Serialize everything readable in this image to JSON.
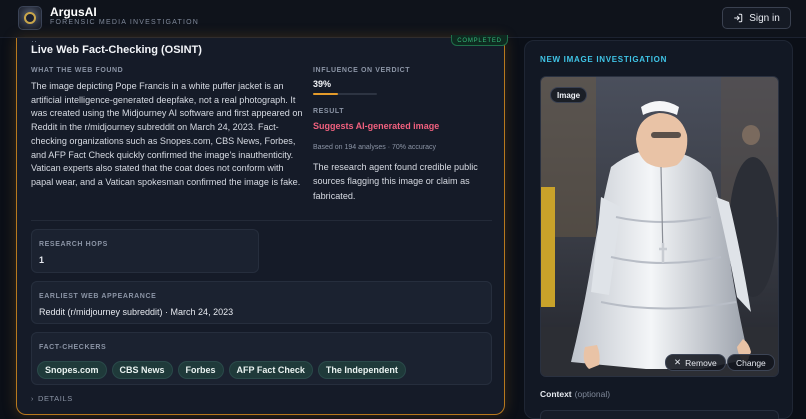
{
  "header": {
    "app_name": "ArgusAI",
    "subtitle": "FORENSIC MEDIA INVESTIGATION",
    "signin_label": "Sign in"
  },
  "result_card": {
    "status_badge": "COMPLETED",
    "title": "Live Web Fact-Checking (OSINT)",
    "web_found_label": "WHAT THE WEB FOUND",
    "web_found_text": "The image depicting Pope Francis in a white puffer jacket is an artificial intelligence-generated deepfake, not a real photograph. It was created using the Midjourney AI software and first appeared on Reddit in the r/midjourney subreddit on March 24, 2023. Fact-checking organizations such as Snopes.com, CBS News, Forbes, and AFP Fact Check quickly confirmed the image's inauthenticity. Vatican experts also stated that the coat does not conform with papal wear, and a Vatican spokesman confirmed the image is fake.",
    "influence_label": "INFLUENCE ON VERDICT",
    "influence_value": "39%",
    "influence_fraction": 0.39,
    "result_label": "RESULT",
    "result_value": "Suggests AI-generated image",
    "result_color": "#f0607e",
    "based_on": "Based on 194 analyses · 70% accuracy",
    "result_text": "The research agent found credible public sources flagging this image or claim as fabricated.",
    "research_hops_label": "RESEARCH HOPS",
    "research_hops_value": "1",
    "earliest_label": "EARLIEST WEB APPEARANCE",
    "earliest_value": "Reddit (r/midjourney subreddit) · March 24, 2023",
    "fact_checkers_label": "FACT-CHECKERS",
    "fact_checkers": [
      "Snopes.com",
      "CBS News",
      "Forbes",
      "AFP Fact Check",
      "The Independent"
    ],
    "details_label": "DETAILS"
  },
  "investigation": {
    "title": "NEW IMAGE INVESTIGATION",
    "image_badge": "Image",
    "remove_label": "Remove",
    "change_label": "Change",
    "context_label": "Context",
    "context_optional": "(optional)"
  },
  "colors": {
    "accent_cyan": "#3fc4e6",
    "card_border": "#b8791e",
    "completed_green": "#35b97a",
    "influence_bar": "#e49b2a",
    "chip_bg": "#1f3a3a"
  }
}
